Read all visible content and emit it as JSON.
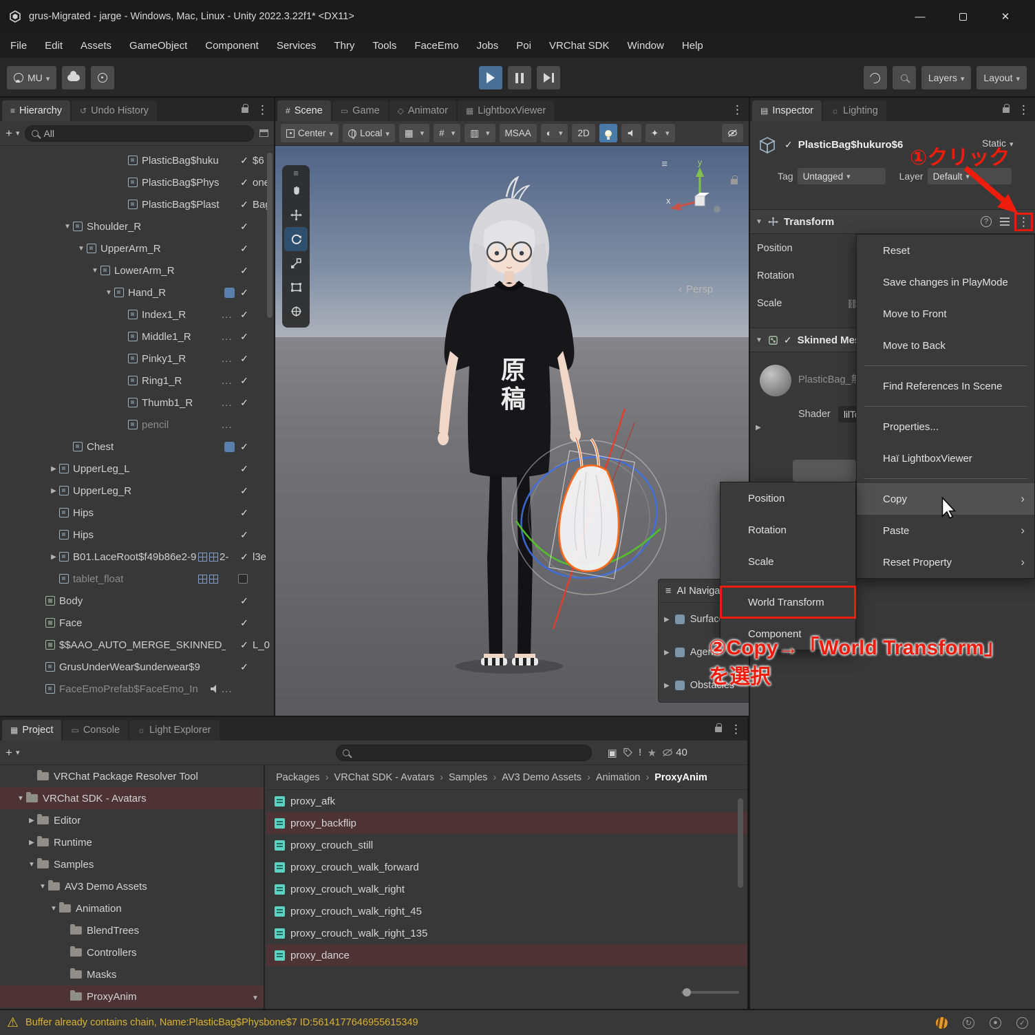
{
  "theme": {
    "red": "#ee1c0c",
    "sel": "#4e3336",
    "acc": "#4f7dab",
    "warn": "#d9b239",
    "teal": "#5fd3c3"
  },
  "titlebar": {
    "title": "grus-Migrated - jarge - Windows, Mac, Linux - Unity 2022.3.22f1* <DX11>",
    "controls": {
      "minimize": "—",
      "close": "✕"
    }
  },
  "menubar": {
    "items": [
      "File",
      "Edit",
      "Assets",
      "GameObject",
      "Component",
      "Services",
      "Thry",
      "Tools",
      "FaceEmo",
      "Jobs",
      "Poi",
      "VRChat SDK",
      "Window",
      "Help"
    ]
  },
  "toolbar": {
    "account": "MU",
    "layers": "Layers",
    "layout": "Layout"
  },
  "hierarchy": {
    "tabs": [
      {
        "label": "Hierarchy",
        "active": true
      },
      {
        "label": "Undo History",
        "active": false
      }
    ],
    "search": "All",
    "rows": [
      {
        "label": "PlasticBag$huku",
        "after": "$6",
        "depth": 8,
        "icon": "cube",
        "check": true
      },
      {
        "label": "PlasticBag$Phys",
        "after": "one",
        "depth": 8,
        "icon": "cube",
        "check": true
      },
      {
        "label": "PlasticBag$Plast",
        "after": "Bag",
        "depth": 8,
        "icon": "cube",
        "check": true
      },
      {
        "label": "Shoulder_R",
        "depth": 4,
        "arrow": "▼",
        "icon": "cube",
        "check": true
      },
      {
        "label": "UpperArm_R",
        "depth": 5,
        "arrow": "▼",
        "icon": "cube",
        "check": true
      },
      {
        "label": "LowerArm_R",
        "depth": 6,
        "arrow": "▼",
        "icon": "cube",
        "check": true
      },
      {
        "label": "Hand_R",
        "depth": 7,
        "arrow": "▼",
        "icon": "cube",
        "badge": true,
        "check": true
      },
      {
        "label": "Index1_R",
        "depth": 8,
        "icon": "cube",
        "dots": true,
        "check": true
      },
      {
        "label": "Middle1_R",
        "depth": 8,
        "icon": "cube",
        "dots": true,
        "check": true
      },
      {
        "label": "Pinky1_R",
        "depth": 8,
        "icon": "cube",
        "dots": true,
        "check": true
      },
      {
        "label": "Ring1_R",
        "depth": 8,
        "icon": "cube",
        "dots": true,
        "check": true
      },
      {
        "label": "Thumb1_R",
        "depth": 8,
        "icon": "cube",
        "dots": true,
        "check": true
      },
      {
        "label": "pencil",
        "depth": 8,
        "icon": "cube",
        "dots": true,
        "dim": true
      },
      {
        "label": "Chest",
        "depth": 4,
        "icon": "cube",
        "badge": true,
        "check": true
      },
      {
        "label": "UpperLeg_L",
        "depth": 3,
        "arrow": "▶",
        "icon": "cube",
        "check": true
      },
      {
        "label": "UpperLeg_R",
        "depth": 3,
        "arrow": "▶",
        "icon": "cube",
        "check": true
      },
      {
        "label": "Hips",
        "depth": 3,
        "icon": "cube",
        "check": true
      },
      {
        "label": "Hips",
        "depth": 3,
        "icon": "cube",
        "check": true
      },
      {
        "label": "B01.LaceRoot$f49b86e2-9",
        "mid": "2-",
        "after": "l3e",
        "depth": 3,
        "arrow": "▶",
        "icon": "cube",
        "grids": true,
        "check": true
      },
      {
        "label": "tablet_float",
        "depth": 3,
        "icon": "cube",
        "grids": true,
        "dim": true,
        "check": false
      },
      {
        "label": "Body",
        "depth": 2,
        "icon": "mesh",
        "check": true
      },
      {
        "label": "Face",
        "depth": 2,
        "icon": "mesh",
        "check": true
      },
      {
        "label": "$$AAO_AUTO_MERGE_SKINNED_ME",
        "after": "L_0",
        "depth": 2,
        "icon": "mesh",
        "check": true
      },
      {
        "label": "GrusUnderWear$underwear$9",
        "depth": 2,
        "icon": "cube",
        "check": true
      },
      {
        "label": "FaceEmoPrefab$FaceEmo_In",
        "depth": 2,
        "icon": "cube",
        "audio": true,
        "dots": true,
        "dim": true
      }
    ]
  },
  "scene": {
    "tabs": [
      {
        "label": "Scene",
        "active": true
      },
      {
        "label": "Game"
      },
      {
        "label": "Animator"
      },
      {
        "label": "LightboxViewer"
      }
    ],
    "toolbar": {
      "pivot": "Center",
      "orientation": "Local",
      "msaa": "MSAA",
      "mode2d": "2D"
    },
    "gizmo": {
      "x": "x",
      "y": "y",
      "persp": "Persp"
    },
    "shirt_text": "原稿",
    "nav_overlay": {
      "title": "AI Navigation",
      "items": [
        "Surfaces",
        "Agents",
        "Obstacles"
      ]
    }
  },
  "inspector": {
    "tabs": [
      {
        "label": "Inspector",
        "active": true
      },
      {
        "label": "Lighting"
      }
    ],
    "object": {
      "name": "PlasticBag$hukuro$6",
      "static": "Static",
      "tag_label": "Tag",
      "tag": "Untagged",
      "layer_label": "Layer",
      "layer": "Default"
    },
    "transform": {
      "title": "Transform",
      "rows": [
        "Position",
        "Rotation",
        "Scale"
      ]
    },
    "renderer": {
      "title": "Skinned Mesh Renderer",
      "material": "PlasticBag_無",
      "shader_label": "Shader",
      "shader": "lilToon"
    }
  },
  "context_menu": {
    "items": [
      {
        "label": "Reset"
      },
      {
        "label": "Save changes in PlayMode"
      },
      {
        "label": "Move to Front"
      },
      {
        "label": "Move to Back"
      },
      {
        "sep": true
      },
      {
        "label": "Find References In Scene"
      },
      {
        "sep": true
      },
      {
        "label": "Properties..."
      },
      {
        "label": "Haï LightboxViewer"
      },
      {
        "sep": true
      },
      {
        "label": "Copy",
        "arrow": true,
        "hover": true
      },
      {
        "label": "Paste",
        "arrow": true
      },
      {
        "label": "Reset Property",
        "arrow": true
      }
    ]
  },
  "submenu": {
    "items": [
      {
        "label": "Position"
      },
      {
        "label": "Rotation"
      },
      {
        "label": "Scale"
      },
      {
        "sep": true
      },
      {
        "label": "World Transform",
        "redbox": true
      },
      {
        "label": "Component"
      }
    ]
  },
  "annotations": {
    "step1": "①クリック",
    "step2": "②Copy→「World Transform」",
    "step2b": "を選択"
  },
  "project": {
    "tabs": [
      {
        "label": "Project",
        "active": true
      },
      {
        "label": "Console"
      },
      {
        "label": "Light Explorer"
      }
    ],
    "count": "40",
    "folders": [
      {
        "label": "VRChat Package Resolver Tool",
        "depth": 1
      },
      {
        "label": "VRChat SDK - Avatars",
        "depth": 0,
        "arrow": "▼",
        "selected": true
      },
      {
        "label": "Editor",
        "depth": 1,
        "arrow": "▶"
      },
      {
        "label": "Runtime",
        "depth": 1,
        "arrow": "▶"
      },
      {
        "label": "Samples",
        "depth": 1,
        "arrow": "▼"
      },
      {
        "label": "AV3 Demo Assets",
        "depth": 2,
        "arrow": "▼"
      },
      {
        "label": "Animation",
        "depth": 3,
        "arrow": "▼"
      },
      {
        "label": "BlendTrees",
        "depth": 4
      },
      {
        "label": "Controllers",
        "depth": 4
      },
      {
        "label": "Masks",
        "depth": 4
      },
      {
        "label": "ProxyAnim",
        "depth": 4,
        "selected": true
      }
    ],
    "breadcrumb": [
      "Packages",
      "VRChat SDK - Avatars",
      "Samples",
      "AV3 Demo Assets",
      "Animation",
      "ProxyAnim"
    ],
    "files": [
      {
        "name": "proxy_afk"
      },
      {
        "name": "proxy_backflip",
        "selected": true
      },
      {
        "name": "proxy_crouch_still"
      },
      {
        "name": "proxy_crouch_walk_forward"
      },
      {
        "name": "proxy_crouch_walk_right"
      },
      {
        "name": "proxy_crouch_walk_right_45"
      },
      {
        "name": "proxy_crouch_walk_right_135"
      },
      {
        "name": "proxy_dance",
        "selected": true
      }
    ]
  },
  "statusbar": {
    "message": "Buffer already contains chain, Name:PlasticBag$Physbone$7 ID:5614177646955615349"
  }
}
